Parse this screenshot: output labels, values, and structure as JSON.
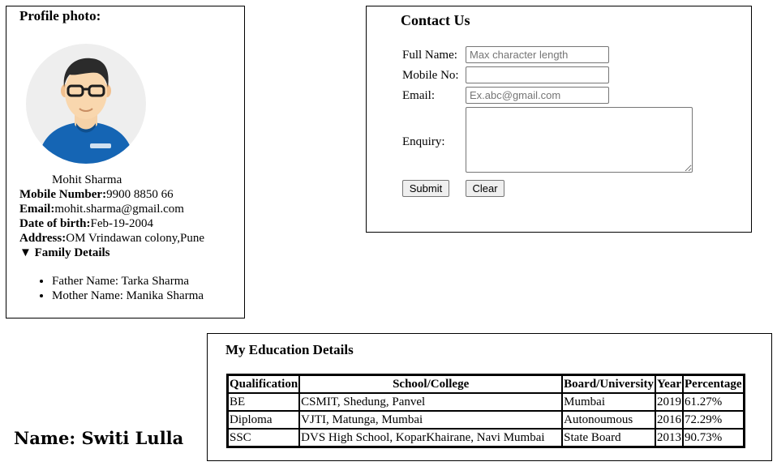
{
  "profile": {
    "title": "Profile photo:",
    "name": "Mohit Sharma",
    "mobile_label": "Mobile Number:",
    "mobile": "9900 8850 66",
    "email_label": "Email:",
    "email": "mohit.sharma@gmail.com",
    "dob_label": "Date of birth:",
    "dob": "Feb-19-2004",
    "address_label": "Address:",
    "address": "OM Vrindawan colony,Pune",
    "family_toggle": "▼ Family Details",
    "family": [
      "Father Name: Tarka Sharma",
      "Mother Name: Manika Sharma"
    ]
  },
  "contact": {
    "title": "Contact Us",
    "full_name_label": "Full Name:",
    "full_name_placeholder": "Max character length",
    "mobile_label": "Mobile No:",
    "mobile_placeholder": "",
    "email_label": "Email:",
    "email_placeholder": "Ex.abc@gmail.com",
    "enquiry_label": "Enquiry:",
    "submit_label": "Submit",
    "clear_label": "Clear"
  },
  "education": {
    "title": "My Education Details",
    "headers": [
      "Qualification",
      "School/College",
      "Board/University",
      "Year",
      "Percentage"
    ],
    "rows": [
      [
        "BE",
        "CSMIT, Shedung, Panvel",
        "Mumbai",
        "2019",
        "61.27%"
      ],
      [
        "Diploma",
        "VJTI, Matunga, Mumbai",
        "Autonoumous",
        "2016",
        "72.29%"
      ],
      [
        "SSC",
        "DVS High School, KoparKhairane, Navi Mumbai",
        "State Board",
        "2013",
        "90.73%"
      ]
    ]
  },
  "footer": {
    "name": "Name: Switi Lulla"
  }
}
